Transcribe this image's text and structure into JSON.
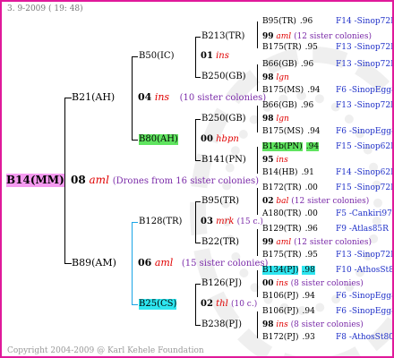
{
  "header": {
    "date": "3. 9-2009 ( 19: 48)"
  },
  "footer": {
    "copyright": "Copyright 2004-2009 @ Karl Kehele Foundation"
  },
  "root": {
    "id": "B14(MM)",
    "gen": "08",
    "line": "aml",
    "note": "(Drones from 16 sister colonies)"
  },
  "g1": [
    {
      "id": "B21(AH)",
      "gen": "04",
      "line": "ins",
      "note": "(10 sister colonies)"
    },
    {
      "id": "B89(AM)",
      "gen": "06",
      "line": "aml",
      "note": "(15 sister colonies)"
    }
  ],
  "g2": [
    {
      "id": "B50(IC)",
      "gen": "01",
      "line": "ins"
    },
    {
      "id": "B80(AH)",
      "gen": "00",
      "line": "hbpn"
    },
    {
      "id": "B128(TR)",
      "gen": "03",
      "line": "mrk",
      "note": "(15 c.)"
    },
    {
      "id": "B25(CS)",
      "gen": "02",
      "line": "thl",
      "note": "(10 c.)"
    }
  ],
  "g3": [
    {
      "id": "B213(TR)",
      "gen": "99",
      "line": "aml",
      "note": "(12 sister colonies)"
    },
    {
      "id": "B250(GB)",
      "gen": "98",
      "line": "lgn"
    },
    {
      "id": "B250(GB)",
      "gen": "98",
      "line": "lgn"
    },
    {
      "id": "B141(PN)",
      "gen": "95",
      "line": "ins"
    },
    {
      "id": "B95(TR)",
      "gen": "02",
      "line": "bal",
      "note": "(12 sister colonies)"
    },
    {
      "id": "B22(TR)",
      "gen": "99",
      "line": "aml",
      "note": "(12 sister colonies)"
    },
    {
      "id": "B126(PJ)",
      "gen": "00",
      "line": "ins",
      "note": "(8 sister colonies)"
    },
    {
      "id": "B238(PJ)",
      "gen": "98",
      "line": "ins",
      "note": "(8 sister colonies)"
    }
  ],
  "g4": [
    {
      "id": "B95(TR)",
      "val": ".96",
      "tag": "F14 -Sinop72R"
    },
    {
      "id": "B175(TR)",
      "val": ".95",
      "tag": "F13 -Sinop72R"
    },
    {
      "id": "B66(GB)",
      "val": ".96",
      "tag": "F13 -Sinop72R"
    },
    {
      "id": "B175(MS)",
      "val": ".94",
      "tag": "F6 -SinopEgg86R"
    },
    {
      "id": "B66(GB)",
      "val": ".96",
      "tag": "F13 -Sinop72R"
    },
    {
      "id": "B175(MS)",
      "val": ".94",
      "tag": "F6 -SinopEgg86R"
    },
    {
      "id": "B14b(PN)",
      "val": ".94",
      "tag": "F15 -Sinop62R"
    },
    {
      "id": "B14(HB)",
      "val": ".91",
      "tag": "F14 -Sinop62R"
    },
    {
      "id": "B172(TR)",
      "val": ".00",
      "tag": "F15 -Sinop72R"
    },
    {
      "id": "A180(TR)",
      "val": ".00",
      "tag": "F5 -Cankiri97R"
    },
    {
      "id": "B129(TR)",
      "val": ".96",
      "tag": "F9 -Atlas85R"
    },
    {
      "id": "B175(TR)",
      "val": ".95",
      "tag": "F13 -Sinop72R"
    },
    {
      "id": "B134(PJ)",
      "val": ".98",
      "tag": "F10 -AthosSt80R"
    },
    {
      "id": "B106(PJ)",
      "val": ".94",
      "tag": "F6 -SinopEgg86R"
    },
    {
      "id": "B106(PJ)",
      "val": ".94",
      "tag": "F6 -SinopEgg86R"
    },
    {
      "id": "B172(PJ)",
      "val": ".93",
      "tag": "F8 -AthosSt80R"
    }
  ]
}
